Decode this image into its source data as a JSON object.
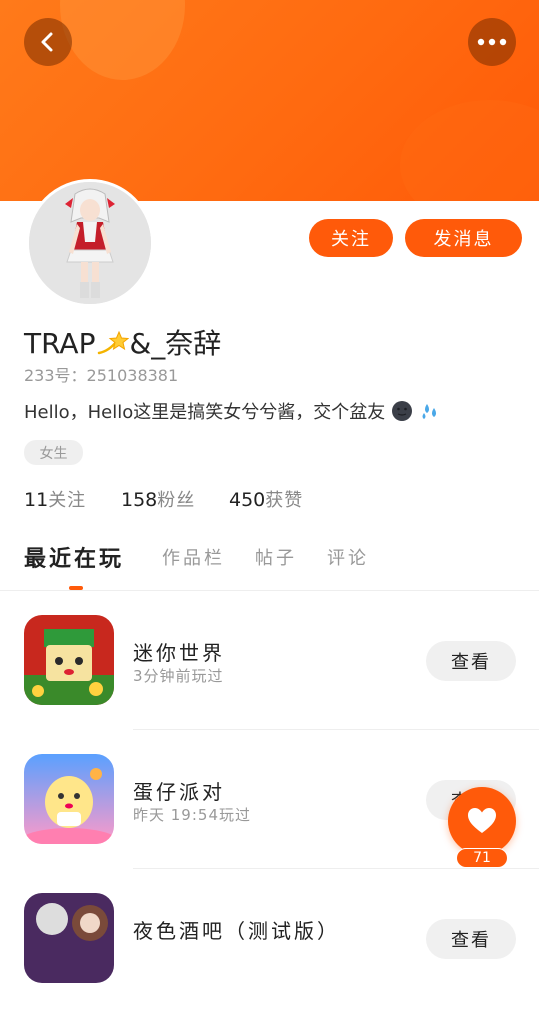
{
  "header": {
    "back_icon": "chevron-left-icon",
    "more_icon": "more-dots-icon",
    "banner_color": "#ff6a10"
  },
  "profile": {
    "avatar_icon": "avatar-character-image",
    "username_prefix": "TRAP",
    "username_suffix": "&_奈辞",
    "uid": "233号：251038381",
    "bio": "Hello，Hello这里是搞笑女兮兮酱，交个盆友",
    "gender_tag": "女生"
  },
  "actions": {
    "follow_label": "关注",
    "message_label": "发消息",
    "accent_color": "#ff5a0a"
  },
  "stats": {
    "following_count": "11",
    "following_label": "关注",
    "fans_count": "158",
    "fans_label": "粉丝",
    "likes_count": "450",
    "likes_label": "获赞"
  },
  "tabs": [
    {
      "label": "最近在玩",
      "active": true
    },
    {
      "label": "作品栏",
      "active": false
    },
    {
      "label": "帖子",
      "active": false
    },
    {
      "label": "评论",
      "active": false
    }
  ],
  "games": [
    {
      "name": "迷你世界",
      "time": "3分钟前玩过",
      "button": "查看"
    },
    {
      "name": "蛋仔派对",
      "time": "昨天 19:54玩过",
      "button": "查看"
    },
    {
      "name": "夜色酒吧（测试版）",
      "time": "",
      "button": "查看"
    }
  ],
  "fab": {
    "icon": "heart-icon",
    "count": "71"
  }
}
